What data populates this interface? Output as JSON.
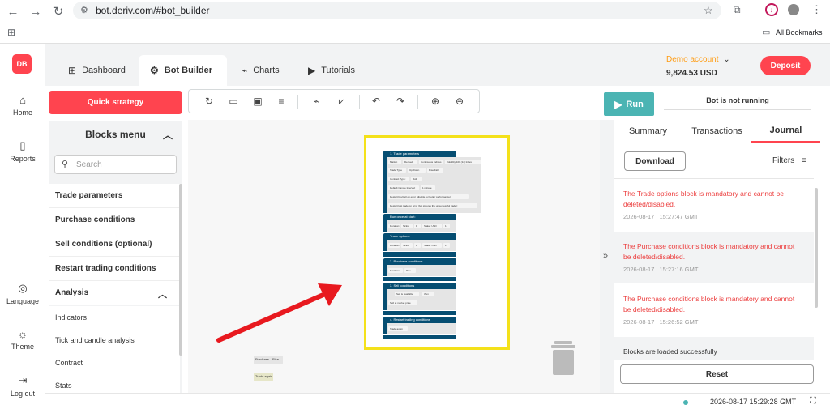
{
  "browser": {
    "url": "bot.deriv.com/#bot_builder",
    "bookmarks_label": "All Bookmarks"
  },
  "rail": {
    "logo": "DB",
    "items": [
      {
        "label": "Home",
        "icon": "home-icon"
      },
      {
        "label": "Reports",
        "icon": "reports-icon"
      },
      {
        "label": "Language",
        "icon": "globe-icon"
      },
      {
        "label": "Theme",
        "icon": "sun-icon"
      },
      {
        "label": "Log out",
        "icon": "logout-icon"
      }
    ]
  },
  "header": {
    "tabs": [
      {
        "label": "Dashboard",
        "icon": "grid-icon"
      },
      {
        "label": "Bot Builder",
        "icon": "puzzle-icon",
        "active": true
      },
      {
        "label": "Charts",
        "icon": "chart-icon"
      },
      {
        "label": "Tutorials",
        "icon": "play-icon"
      }
    ],
    "account_type": "Demo account",
    "balance": "9,824.53 USD",
    "deposit_label": "Deposit"
  },
  "blocks": {
    "quick_strategy": "Quick strategy",
    "title": "Blocks menu",
    "search_placeholder": "Search",
    "items": [
      "Trade parameters",
      "Purchase conditions",
      "Sell conditions (optional)",
      "Restart trading conditions",
      "Analysis"
    ],
    "analysis_items": [
      "Indicators",
      "Tick and candle analysis",
      "Contract",
      "Stats"
    ]
  },
  "workspace": {
    "blocks": [
      {
        "title": "1. Trade parameters"
      },
      {
        "title": "Run once at start:"
      },
      {
        "title": "Trade options:"
      },
      {
        "title": "2. Purchase conditions"
      },
      {
        "title": "3. Sell conditions"
      },
      {
        "title": "4. Restart trading conditions"
      }
    ],
    "rows": {
      "market": "Market",
      "derived": "Derived",
      "continuous": "Continuous Indices",
      "volatility": "Volatility 100 (1s) Index",
      "trade_type": "Trade Type",
      "updown": "Up/Down",
      "risefall": "Rise/Fall",
      "contract_type": "Contract Type:",
      "both": "Both",
      "candle": "Default Candle Interval:",
      "one_minute": "1 minute",
      "restart_buy": "Restart buy/sell on error (disable for better performance):",
      "restart_last": "Restart last trade on error (bot ignores the unsuccessful trade):",
      "duration": "Duration:",
      "ticks": "Ticks",
      "one": "1",
      "stake": "Stake: USD",
      "stake_val": "1",
      "purchase": "Purchase",
      "rise": "Rise",
      "sell_available": "Sell is available",
      "then": "then",
      "sell_at_market": "Sell at market price",
      "trade_again": "Trade again"
    },
    "stray": {
      "purchase": "Purchase",
      "rise": "Rise",
      "trade_again": "Trade again"
    }
  },
  "run_panel": {
    "run_label": "Run",
    "status": "Bot is not running",
    "tabs": [
      "Summary",
      "Transactions",
      "Journal"
    ],
    "download_label": "Download",
    "filters_label": "Filters",
    "reset_label": "Reset",
    "messages": [
      {
        "text": "The Trade options block is mandatory and cannot be deleted/disabled.",
        "time": "2026-08-17 | 15:27:47 GMT",
        "type": "error"
      },
      {
        "text": "The Purchase conditions block is mandatory and cannot be deleted/disabled.",
        "time": "2026-08-17 | 15:27:16 GMT",
        "type": "error"
      },
      {
        "text": "The Purchase conditions block is mandatory and cannot be deleted/disabled.",
        "time": "2026-08-17 | 15:26:52 GMT",
        "type": "error"
      },
      {
        "text": "Blocks are loaded successfully",
        "time": "",
        "type": "info"
      }
    ]
  },
  "footer": {
    "server_time": "2026-08-17 15:29:28 GMT"
  },
  "colors": {
    "brand": "#ff444f",
    "run": "#4bb4b3",
    "highlight": "#f4e11a",
    "arrow": "#e8191f",
    "block_header": "#064e72"
  }
}
